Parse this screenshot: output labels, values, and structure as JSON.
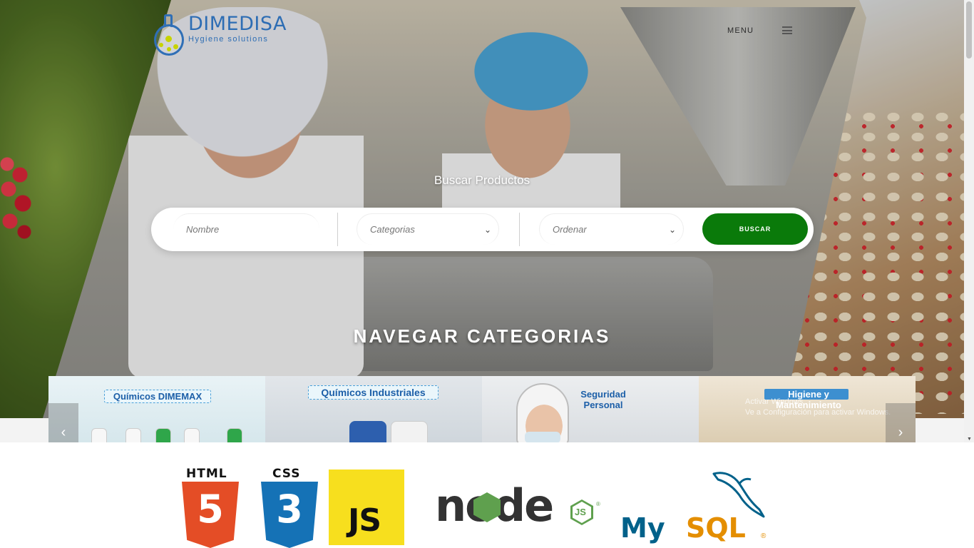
{
  "brand": {
    "name": "DIMEDISA",
    "tagline": "Hygiene solutions",
    "colors": {
      "primary": "#2d6db4",
      "accent": "#c7d300",
      "button": "#0a7a0a"
    }
  },
  "header": {
    "menu_label": "MENU",
    "menu_icon": "hamburger-icon"
  },
  "search": {
    "title": "Buscar Productos",
    "name_placeholder": "Nombre",
    "category_value": "Categorias",
    "order_value": "Ordenar",
    "button_label": "BUSCAR"
  },
  "categories": {
    "heading": "NAVEGAR CATEGORIAS",
    "items": [
      {
        "label": "Químicos DIMEMAX"
      },
      {
        "label": "Químicos Industriales"
      },
      {
        "label_line1": "Seguridad",
        "label_line2": "Personal"
      },
      {
        "label_line1": "Higiene y",
        "label_line2": "Mantenimiento"
      }
    ],
    "prev_icon": "chevron-left-icon",
    "next_icon": "chevron-right-icon"
  },
  "windows_overlay": {
    "line1": "Activar Windows",
    "line2": "Ve a Configuración para activar Windows."
  },
  "tech_logos": {
    "html": {
      "word": "HTML",
      "number": "5"
    },
    "css": {
      "word": "CSS",
      "number": "3"
    },
    "js": {
      "text": "JS"
    },
    "node": {
      "text": "node",
      "badge": "JS",
      "registered": "®"
    },
    "mysql": {
      "my": "My",
      "sql": "SQL",
      "registered": "®"
    }
  }
}
